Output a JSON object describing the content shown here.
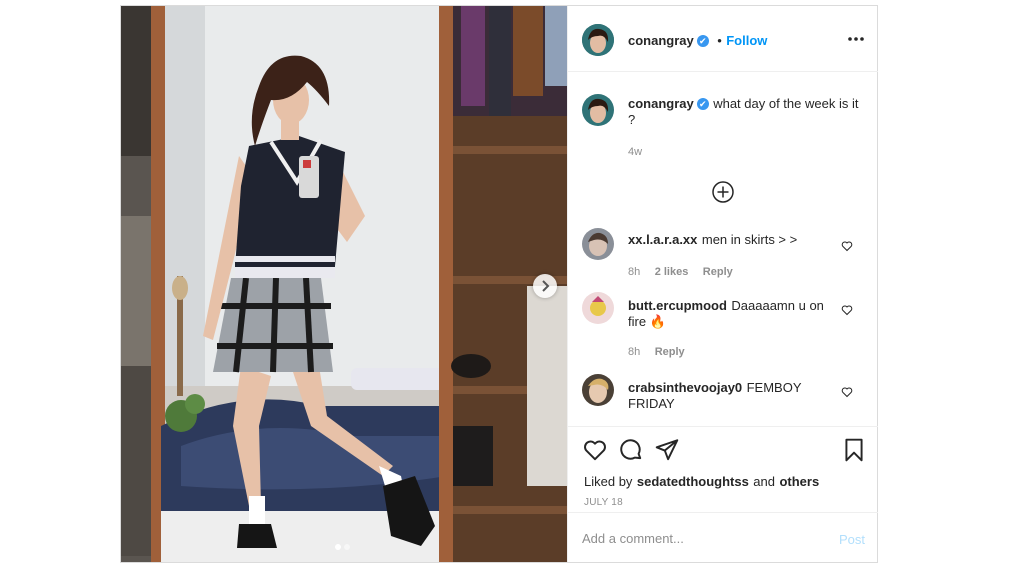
{
  "header": {
    "username": "conangray",
    "verified_mark": "✔",
    "separator": "•",
    "follow_label": "Follow",
    "more_icon": "ellipsis-icon"
  },
  "caption": {
    "username": "conangray",
    "text": "what day of the week is it ?",
    "age": "4w"
  },
  "load_more_icon": "plus-circle-icon",
  "comments": [
    {
      "username": "xx.l.a.r.a.xx",
      "text": "men in skirts > >",
      "age": "8h",
      "likes": "2 likes",
      "reply": "Reply"
    },
    {
      "username": "butt.ercupmood",
      "text": "Daaaaamn u on fire 🔥",
      "age": "8h",
      "likes": "",
      "reply": "Reply"
    },
    {
      "username": "crabsinthevoojay0",
      "text": "FEMBOY FRIDAY",
      "age": "",
      "likes": "",
      "reply": ""
    }
  ],
  "actions": {
    "icons": [
      "heart-icon",
      "comment-icon",
      "share-icon",
      "bookmark-icon"
    ],
    "liked_by_prefix": "Liked by",
    "liked_by_user": "sedatedthoughtss",
    "liked_by_and": "and",
    "liked_by_others": "others",
    "date": "JULY 18"
  },
  "add_comment": {
    "placeholder": "Add a comment...",
    "post_label": "Post"
  },
  "carousel": {
    "dots": 2,
    "active": 0,
    "next_icon": "chevron-right-icon"
  },
  "colors": {
    "accent": "#0095f6",
    "text": "#262626",
    "muted": "#8e8e8e",
    "border": "#dbdbdb",
    "post_disabled": "#b2dffc"
  }
}
